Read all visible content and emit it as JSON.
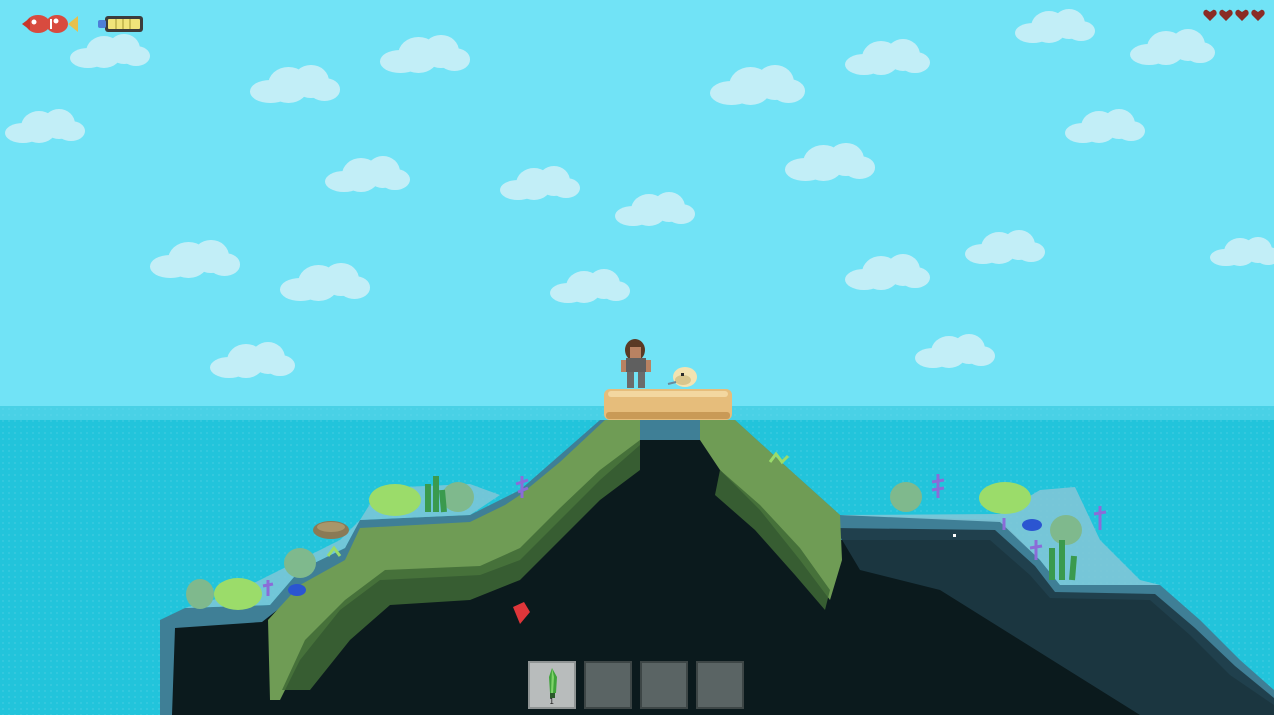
{
  "hud": {
    "hunger_icon": "fish-icon",
    "oxygen_icon": "oxygen-tank-icon",
    "health_icon": "heart-icon",
    "hearts": 4,
    "oxygen_level": 1.0
  },
  "hotbar": {
    "slots": [
      {
        "item_icon": "knife-icon",
        "count": "1",
        "selected": true
      },
      {
        "item_icon": "",
        "count": "",
        "selected": false
      },
      {
        "item_icon": "",
        "count": "",
        "selected": false
      },
      {
        "item_icon": "",
        "count": "",
        "selected": false
      }
    ]
  },
  "scene": {
    "player": "player-character",
    "creature": "cream-critter",
    "cursor": "red-cursor-icon"
  },
  "colors": {
    "sky": "#71e3f6",
    "sea": "#22c4db",
    "cloud": "#c2eef7",
    "grass": "#6f9c55",
    "sand": "#e6bd7b",
    "cave": "#0b1a1d",
    "heart": "#8a2b24"
  }
}
